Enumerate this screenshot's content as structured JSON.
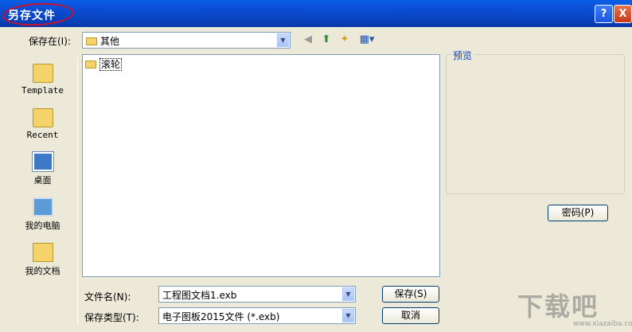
{
  "window": {
    "title": "另存文件",
    "help": "?",
    "close": "X"
  },
  "lookin": {
    "label": "保存在(I):",
    "value": "其他"
  },
  "places": [
    {
      "label": "Template",
      "icon": "folder-icon"
    },
    {
      "label": "Recent",
      "icon": "folder-icon"
    },
    {
      "label": "桌面",
      "icon": "desktop-icon"
    },
    {
      "label": "我的电脑",
      "icon": "computer-icon"
    },
    {
      "label": "我的文档",
      "icon": "documents-icon"
    }
  ],
  "files": [
    {
      "name": "滚轮",
      "icon": "folder-icon"
    }
  ],
  "preview": {
    "title": "预览",
    "password_button": "密码(P)"
  },
  "filename": {
    "label": "文件名(N):",
    "value": "工程图文档1.exb"
  },
  "filetype": {
    "label": "保存类型(T):",
    "value": "电子图板2015文件 (*.exb)"
  },
  "buttons": {
    "save": "保存(S)",
    "cancel": "取消"
  },
  "watermark": {
    "text": "下载吧",
    "url": "www.xiazaiba.com"
  }
}
